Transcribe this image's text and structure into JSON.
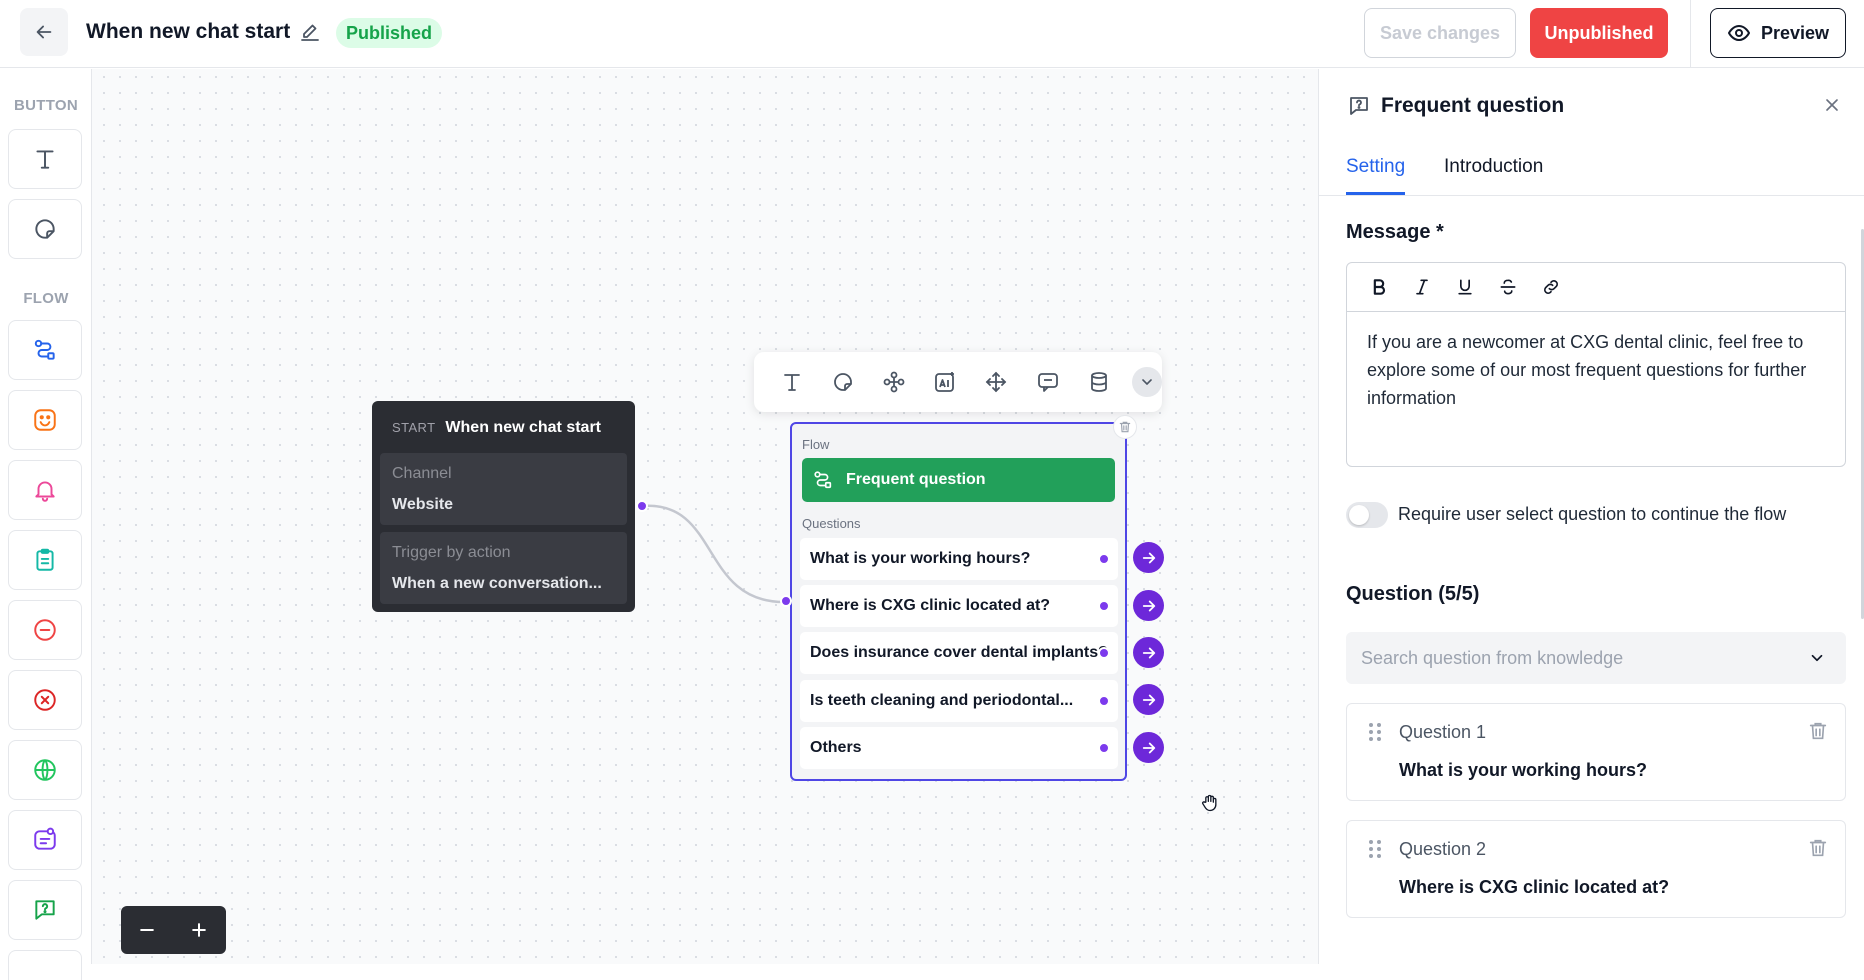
{
  "header": {
    "title": "When new chat start",
    "status_badge": "Published",
    "save_label": "Save changes",
    "unpublish_label": "Unpublished",
    "preview_label": "Preview"
  },
  "toolbox": {
    "button_section": "BUTTON",
    "flow_section": "FLOW",
    "button_tools": [
      "text-icon",
      "sticker-icon"
    ],
    "flow_tools": [
      "flow-icon",
      "emoji-icon",
      "bell-icon",
      "clipboard-icon",
      "minus-circle-icon",
      "close-circle-icon",
      "globe-icon",
      "form-icon",
      "question-bubble-icon"
    ],
    "colors": {
      "flow": "#2563eb",
      "emoji": "#f97316",
      "bell": "#ec4899",
      "clipboard": "#14b8a6",
      "minus": "#ef4444",
      "close": "#dc2626",
      "globe": "#22c55e",
      "form": "#7c3aed",
      "question": "#16a34a"
    }
  },
  "start_node": {
    "tag": "START",
    "title": "When new chat start",
    "channel_label": "Channel",
    "channel_value": "Website",
    "trigger_label": "Trigger by action",
    "trigger_value": "When a new conversation..."
  },
  "node_toolbar": {
    "icons": [
      "text-icon",
      "sticker-icon",
      "hierarchy-icon",
      "ai-icon",
      "move-icon",
      "chat-icon",
      "database-icon",
      "chevron-down-icon"
    ]
  },
  "flow_node": {
    "type_label": "Flow",
    "title": "Frequent question",
    "questions_label": "Questions",
    "questions": [
      "What is your working hours?",
      "Where is CXG clinic located at?",
      "Does insurance cover dental implants?",
      "Is teeth cleaning and periodontal...",
      "Others"
    ]
  },
  "panel": {
    "title": "Frequent question",
    "tabs": [
      "Setting",
      "Introduction"
    ],
    "message_label": "Message *",
    "message_text": "If you are a newcomer at CXG dental clinic, feel free to explore some of our most frequent questions for further information",
    "toggle_label": "Require user select question to continue the flow",
    "toggle_on": false,
    "question_section": "Question (5/5)",
    "search_placeholder": "Search question from knowledge",
    "question_cards": [
      {
        "label": "Question 1",
        "value": "What is your working hours?"
      },
      {
        "label": "Question 2",
        "value": "Where is CXG clinic located at?"
      }
    ]
  },
  "colors": {
    "accent": "#2563eb",
    "danger": "#ef4444",
    "success": "#22a05a",
    "handle": "#7c3aed",
    "node_border": "#4f46e5"
  }
}
